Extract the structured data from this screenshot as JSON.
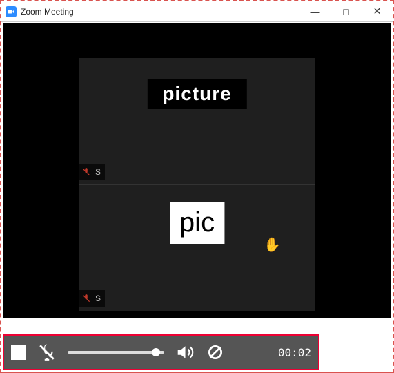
{
  "window": {
    "title": "Zoom Meeting"
  },
  "titlebar": {
    "minimize": "—",
    "maximize": "□",
    "close": "✕"
  },
  "gallery": {
    "tiles": [
      {
        "thumb_label": "picture",
        "name": "S",
        "muted": true
      },
      {
        "thumb_label": "pic",
        "name": "S",
        "muted": true,
        "hand_raised": true
      }
    ]
  },
  "player": {
    "time": "00:02"
  }
}
